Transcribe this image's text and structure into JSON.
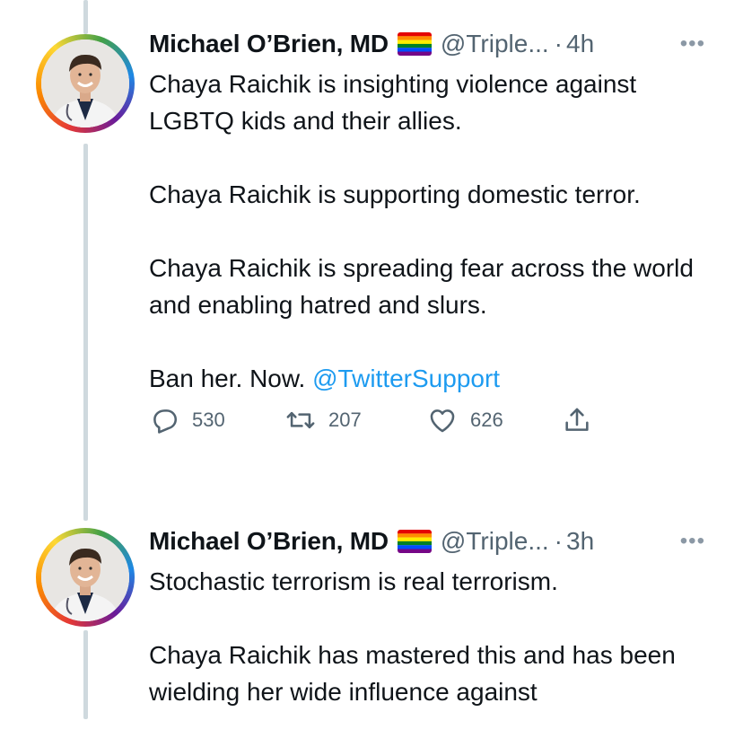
{
  "tweets": [
    {
      "author_name": "Michael O’Brien, MD",
      "author_flag_icon": "rainbow-flag-icon",
      "author_handle": "@Triple...",
      "separator": "·",
      "time": "4h",
      "more_label": "•••",
      "paragraphs": [
        "Chaya Raichik is insighting violence against LGBTQ kids and their allies.",
        "Chaya Raichik is supporting domestic terror.",
        "Chaya Raichik is spreading fear across the world and enabling hatred and slurs."
      ],
      "closing_text": "Ban her. Now.",
      "mention": "@TwitterSupport",
      "replies": "530",
      "retweets": "207",
      "likes": "626"
    },
    {
      "author_name": "Michael O’Brien, MD",
      "author_flag_icon": "rainbow-flag-icon",
      "author_handle": "@Triple...",
      "separator": "·",
      "time": "3h",
      "more_label": "•••",
      "paragraphs": [
        "Stochastic terrorism is real terrorism.",
        "Chaya Raichik has mastered this and has been wielding her wide influence against"
      ]
    }
  ]
}
